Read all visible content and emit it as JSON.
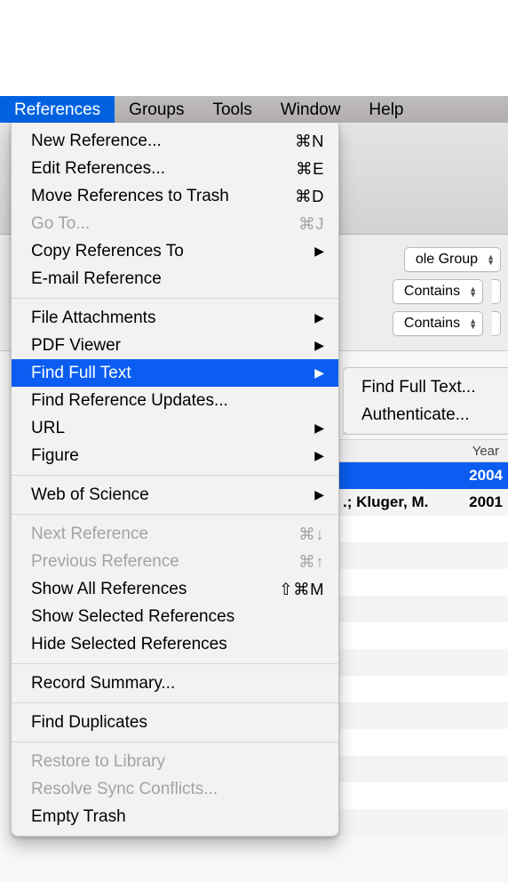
{
  "menubar": {
    "items": [
      "References",
      "Groups",
      "Tools",
      "Window",
      "Help"
    ],
    "active_index": 0
  },
  "menu": {
    "sections": [
      [
        {
          "label": "New Reference...",
          "shortcut": "⌘N"
        },
        {
          "label": "Edit References...",
          "shortcut": "⌘E"
        },
        {
          "label": "Move References to Trash",
          "shortcut": "⌘D"
        },
        {
          "label": "Go To...",
          "shortcut": "⌘J",
          "disabled": true
        },
        {
          "label": "Copy References To",
          "submenu": true
        },
        {
          "label": "E-mail Reference"
        }
      ],
      [
        {
          "label": "File Attachments",
          "submenu": true
        },
        {
          "label": "PDF Viewer",
          "submenu": true
        },
        {
          "label": "Find Full Text",
          "submenu": true,
          "highlight": true
        },
        {
          "label": "Find Reference Updates..."
        },
        {
          "label": "URL",
          "submenu": true
        },
        {
          "label": "Figure",
          "submenu": true
        }
      ],
      [
        {
          "label": "Web of Science",
          "submenu": true
        }
      ],
      [
        {
          "label": "Next Reference",
          "shortcut": "⌘↓",
          "disabled": true
        },
        {
          "label": "Previous Reference",
          "shortcut": "⌘↑",
          "disabled": true
        },
        {
          "label": "Show All References",
          "shortcut": "⇧⌘M"
        },
        {
          "label": "Show Selected References"
        },
        {
          "label": "Hide Selected References"
        }
      ],
      [
        {
          "label": "Record Summary..."
        }
      ],
      [
        {
          "label": "Find Duplicates"
        }
      ],
      [
        {
          "label": "Restore to Library",
          "disabled": true
        },
        {
          "label": "Resolve Sync Conflicts...",
          "disabled": true
        },
        {
          "label": "Empty Trash"
        }
      ]
    ]
  },
  "submenu": {
    "items": [
      {
        "label": "Find Full Text..."
      },
      {
        "label": "Authenticate..."
      }
    ]
  },
  "background": {
    "group_combo_visible_text": "ole Group",
    "filter1": "Contains",
    "filter2": "Contains",
    "year_header": "Year"
  },
  "table": {
    "rows": [
      {
        "author": "",
        "year": "2004",
        "selected": true
      },
      {
        "author": ".; Kluger, M.",
        "year": "2001",
        "selected": false
      }
    ]
  }
}
